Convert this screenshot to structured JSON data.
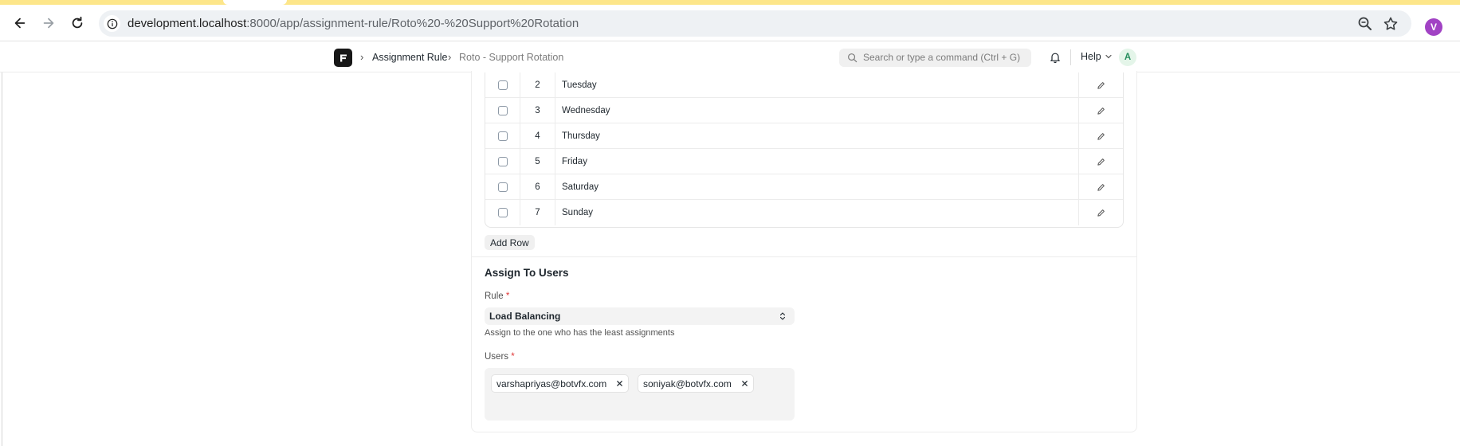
{
  "browser": {
    "url_host": "development.localhost",
    "url_rest": ":8000/app/assignment-rule/Roto%20-%20Support%20Rotation",
    "profile_initial": "V"
  },
  "navbar": {
    "breadcrumbs": [
      "Assignment Rule",
      "Roto - Support Rotation"
    ],
    "search_placeholder": "Search or type a command (Ctrl + G)",
    "help_label": "Help",
    "avatar_initial": "A"
  },
  "schedule_table": {
    "rows": [
      {
        "idx": "2",
        "day": "Tuesday"
      },
      {
        "idx": "3",
        "day": "Wednesday"
      },
      {
        "idx": "4",
        "day": "Thursday"
      },
      {
        "idx": "5",
        "day": "Friday"
      },
      {
        "idx": "6",
        "day": "Saturday"
      },
      {
        "idx": "7",
        "day": "Sunday"
      }
    ],
    "add_row_label": "Add Row"
  },
  "assign_section": {
    "title": "Assign To Users",
    "rule_label": "Rule",
    "required_mark": "*",
    "rule_value": "Load Balancing",
    "rule_description": "Assign to the one who has the least assignments",
    "users_label": "Users",
    "users": [
      "varshapriyas@botvfx.com",
      "soniyak@botvfx.com"
    ]
  },
  "colors": {
    "accent_yellow": "#fde68a",
    "profile_purple": "#a142c4",
    "avatar_green": "#278f5e",
    "required_red": "#e03636"
  }
}
